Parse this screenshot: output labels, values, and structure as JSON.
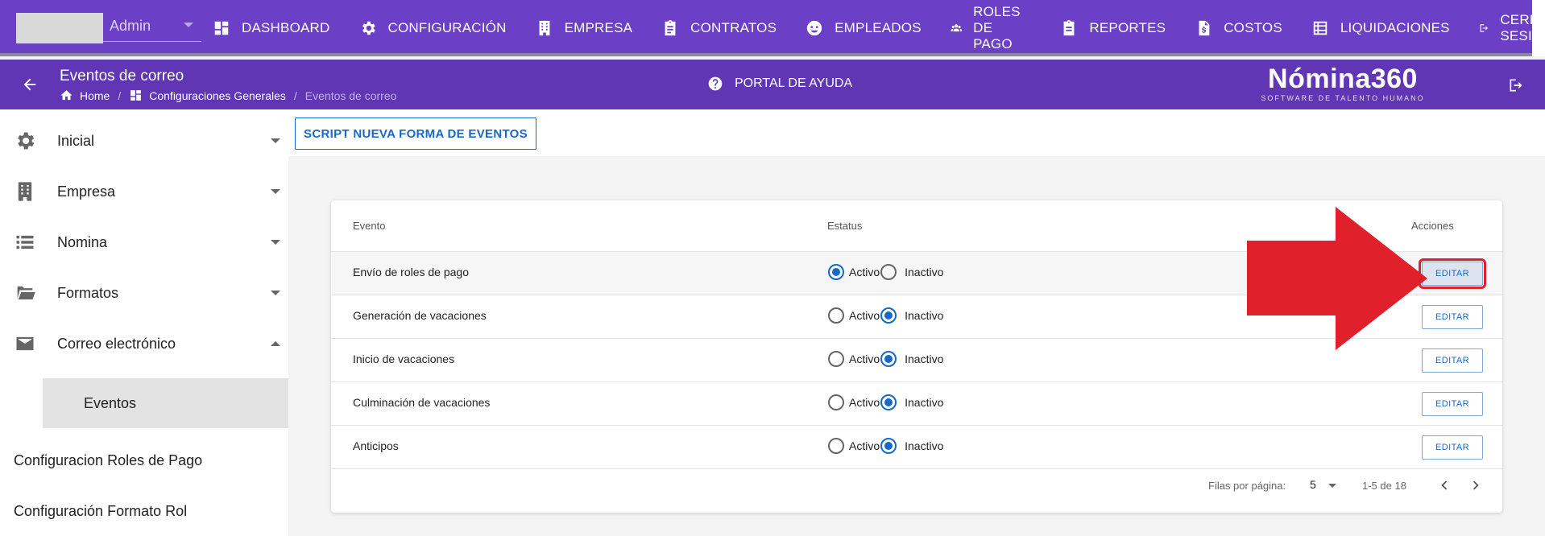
{
  "topnav": {
    "user_label": "Admin",
    "items": [
      {
        "label": "DASHBOARD",
        "icon": "dashboard-icon"
      },
      {
        "label": "CONFIGURACIÓN",
        "icon": "gear-icon"
      },
      {
        "label": "EMPRESA",
        "icon": "building-icon"
      },
      {
        "label": "CONTRATOS",
        "icon": "clipboard-icon"
      },
      {
        "label": "EMPLEADOS",
        "icon": "face-icon"
      },
      {
        "label": "ROLES DE PAGO",
        "icon": "users-icon"
      },
      {
        "label": "REPORTES",
        "icon": "report-icon"
      },
      {
        "label": "COSTOS",
        "icon": "invoice-icon"
      },
      {
        "label": "LIQUIDACIONES",
        "icon": "list-icon"
      },
      {
        "label": "CERRAR SESIÓN",
        "icon": "logout-icon"
      }
    ]
  },
  "subheader": {
    "title": "Eventos de correo",
    "breadcrumb": {
      "home": "Home",
      "section": "Configuraciones Generales",
      "current": "Eventos de correo",
      "separator": "/"
    },
    "help_label": "PORTAL DE AYUDA",
    "brand": {
      "logo": "Nómina360",
      "tagline": "SOFTWARE DE TALENTO HUMANO"
    }
  },
  "sidebar": {
    "items": [
      {
        "label": "Inicial",
        "icon": "gear-icon"
      },
      {
        "label": "Empresa",
        "icon": "building-icon"
      },
      {
        "label": "Nomina",
        "icon": "list-icon"
      },
      {
        "label": "Formatos",
        "icon": "folder-open-icon"
      },
      {
        "label": "Correo electrónico",
        "icon": "mail-icon"
      }
    ],
    "subitem": "Eventos",
    "plain_items": [
      "Configuracion Roles de Pago",
      "Configuración Formato Rol"
    ]
  },
  "toolbar": {
    "script_button": "SCRIPT NUEVA FORMA DE EVENTOS"
  },
  "table": {
    "headers": {
      "evento": "Evento",
      "estatus": "Estatus",
      "acciones": "Acciones"
    },
    "active_label": "Activo",
    "inactive_label": "Inactivo",
    "edit_label": "EDITAR",
    "rows": [
      {
        "evento": "Envío de roles de pago",
        "status": "Activo"
      },
      {
        "evento": "Generación de vacaciones",
        "status": "Inactivo"
      },
      {
        "evento": "Inicio de vacaciones",
        "status": "Inactivo"
      },
      {
        "evento": "Culminación de vacaciones",
        "status": "Inactivo"
      },
      {
        "evento": "Anticipos",
        "status": "Inactivo"
      }
    ],
    "footer": {
      "rows_per_page_label": "Filas por página:",
      "rows_per_page": "5",
      "range": "1-5 de 18"
    }
  },
  "colors": {
    "nav": "#6c3fc7",
    "subheader": "#6136b5",
    "accent": "#1769c9",
    "annotation": "#e0202a"
  }
}
